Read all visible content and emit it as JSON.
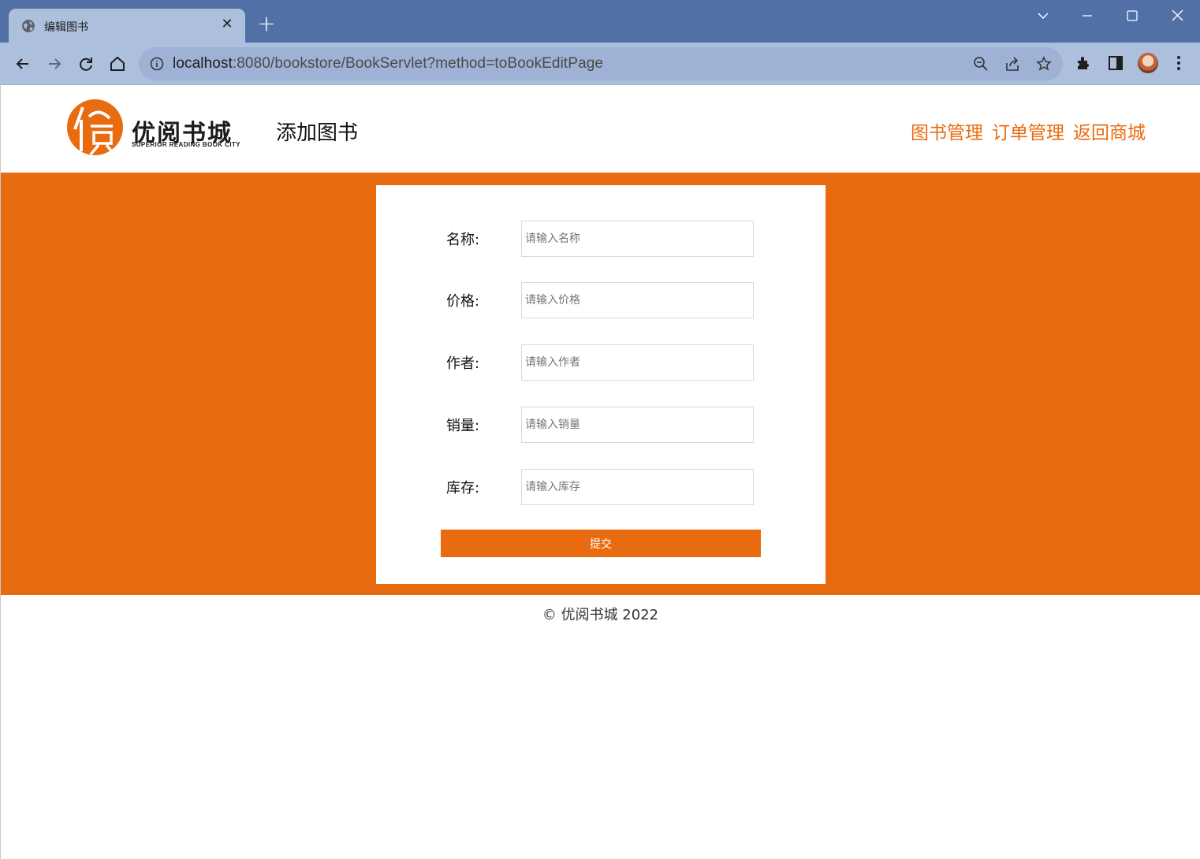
{
  "browser": {
    "tab_title": "编辑图书",
    "tab_close": "✕",
    "new_tab": "+",
    "url_host": "localhost",
    "url_rest": ":8080/bookstore/BookServlet?method=toBookEditPage"
  },
  "site": {
    "logo_text": "优阅书城",
    "logo_sub": "SUPERIOR READING BOOK CITY",
    "page_title": "添加图书",
    "nav": [
      "图书管理",
      "订单管理",
      "返回商城"
    ]
  },
  "form": {
    "fields": [
      {
        "label": "名称:",
        "placeholder": "请输入名称"
      },
      {
        "label": "价格:",
        "placeholder": "请输入价格"
      },
      {
        "label": "作者:",
        "placeholder": "请输入作者"
      },
      {
        "label": "销量:",
        "placeholder": "请输入销量"
      },
      {
        "label": "库存:",
        "placeholder": "请输入库存"
      }
    ],
    "submit_label": "提交"
  },
  "footer": {
    "text": "© 优阅书城 2022"
  },
  "colors": {
    "accent": "#e96b0f",
    "titlebar": "#5170a6",
    "toolbar": "#acbfdd"
  },
  "icons": [
    "globe-icon",
    "back-icon",
    "forward-icon",
    "reload-icon",
    "home-icon",
    "info-icon",
    "zoom-icon",
    "share-icon",
    "star-icon",
    "extensions-icon",
    "sidepanel-icon",
    "menu-icon",
    "minimize-icon",
    "maximize-icon",
    "close-window-icon",
    "tab-search-icon"
  ]
}
